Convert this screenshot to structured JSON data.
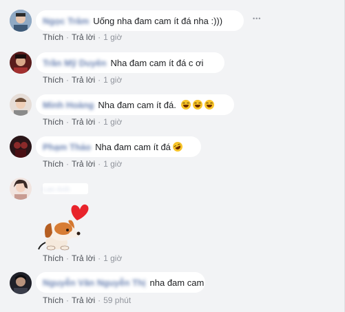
{
  "actions": {
    "like": "Thích",
    "reply": "Trả lời",
    "separator": "·"
  },
  "more_label": "•••",
  "comments": [
    {
      "author": "Ngọc Trâm",
      "text": "Uống nha đam cam ít đá nha :)))",
      "time": "1 giờ",
      "avatar_color": "#6b8cae"
    },
    {
      "author": "Trần Mỹ Duyên",
      "text": "Nha đam cam ít đá c ơi",
      "time": "1 giờ",
      "avatar_color": "#7a2e2e"
    },
    {
      "author": "Minh Hoàng",
      "text": "Nha đam cam ít đá.",
      "emojis": [
        "😂",
        "😂",
        "😂"
      ],
      "time": "1 giờ",
      "avatar_color": "#c9a98f"
    },
    {
      "author": "Phạm Thảo",
      "text": "Nha đam cam ít đá",
      "emojis": [
        "🤣"
      ],
      "time": "1 giờ",
      "avatar_color": "#3a1f24"
    },
    {
      "author": "Lan Anh",
      "text": "",
      "sticker": "puppy-heart-sticker",
      "time": "1 giờ",
      "avatar_color": "#d7b9b0"
    },
    {
      "author": "Nguyễn Văn Nguyễn Thị",
      "text": "nha đam cam",
      "time": "59 phút",
      "avatar_color": "#2c2c34"
    }
  ]
}
